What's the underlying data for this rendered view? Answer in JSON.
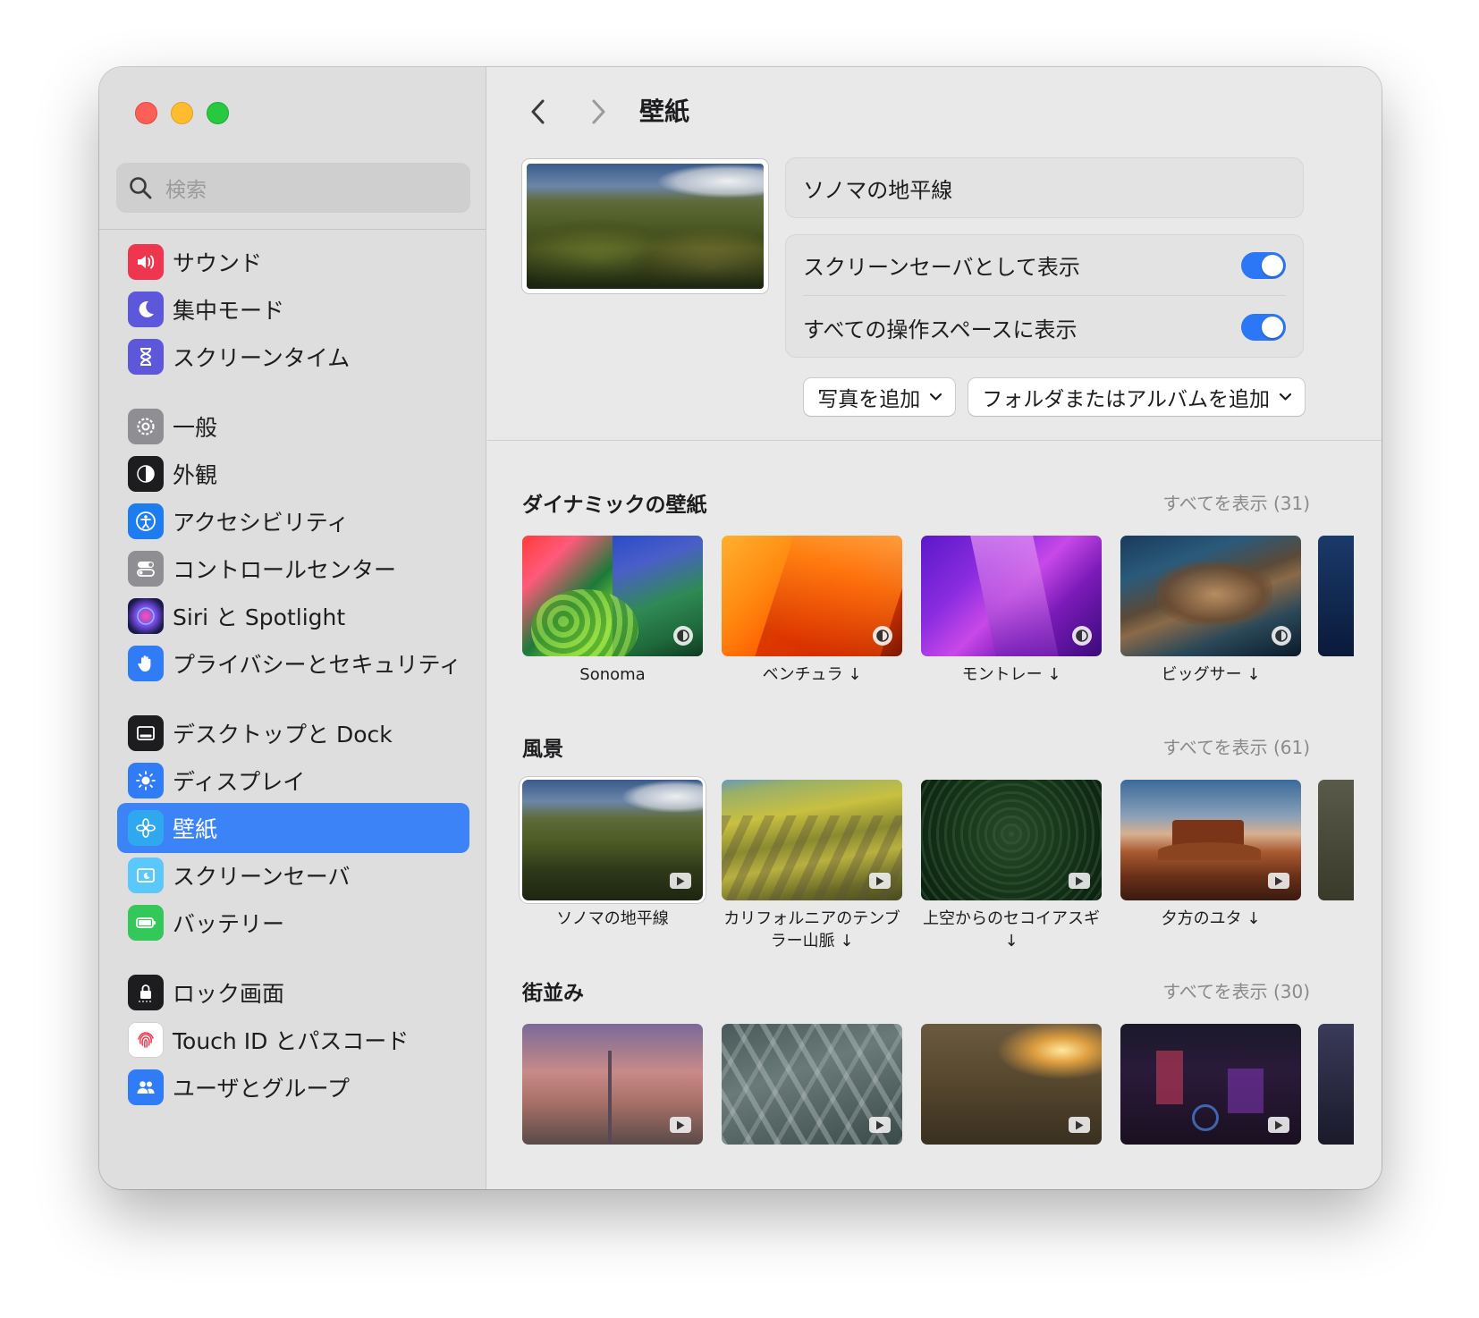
{
  "search": {
    "placeholder": "検索"
  },
  "sidebar": {
    "items": [
      {
        "label": "サウンド",
        "icon": "speaker-icon",
        "color": "#f0364f"
      },
      {
        "label": "集中モード",
        "icon": "moon-icon",
        "color": "#5d57dc"
      },
      {
        "label": "スクリーンタイム",
        "icon": "hourglass-icon",
        "color": "#5d57dc"
      },
      {
        "label": "一般",
        "icon": "gear-icon",
        "color": "#8e8e93"
      },
      {
        "label": "外観",
        "icon": "appearance-icon",
        "color": "#1d1d1f"
      },
      {
        "label": "アクセシビリティ",
        "icon": "accessibility-icon",
        "color": "#1c7cf0"
      },
      {
        "label": "コントロールセンター",
        "icon": "control-center-icon",
        "color": "#8e8e93"
      },
      {
        "label": "Siri と Spotlight",
        "icon": "siri-icon",
        "color": "#4e2a8e"
      },
      {
        "label": "プライバシーとセキュリティ",
        "icon": "hand-icon",
        "color": "#2f7cf6"
      },
      {
        "label": "デスクトップと Dock",
        "icon": "dock-icon",
        "color": "#1d1d1f"
      },
      {
        "label": "ディスプレイ",
        "icon": "sun-icon",
        "color": "#2f7cf6"
      },
      {
        "label": "壁紙",
        "icon": "flower-icon",
        "color": "#2fa8f0"
      },
      {
        "label": "スクリーンセーバ",
        "icon": "screensaver-icon",
        "color": "#5ac8fa"
      },
      {
        "label": "バッテリー",
        "icon": "battery-icon",
        "color": "#34c759"
      },
      {
        "label": "ロック画面",
        "icon": "lock-icon",
        "color": "#1d1d1f"
      },
      {
        "label": "Touch ID とパスコード",
        "icon": "fingerprint-icon",
        "color": "#ffffff"
      },
      {
        "label": "ユーザとグループ",
        "icon": "users-icon",
        "color": "#2f7cf6"
      }
    ],
    "active_label": "壁紙"
  },
  "header": {
    "title": "壁紙"
  },
  "current": {
    "name": "ソノマの地平線",
    "toggle_screensaver": {
      "label": "スクリーンセーバとして表示",
      "on": true
    },
    "toggle_all_spaces": {
      "label": "すべての操作スペースに表示",
      "on": true
    },
    "add_photo": "写真を追加",
    "add_folder": "フォルダまたはアルバムを追加"
  },
  "sections": [
    {
      "title": "ダイナミックの壁紙",
      "show_all": "すべてを表示 (31)",
      "items": [
        {
          "label": "Sonoma"
        },
        {
          "label": "ベンチュラ ↓"
        },
        {
          "label": "モントレー ↓"
        },
        {
          "label": "ビッグサー ↓"
        }
      ]
    },
    {
      "title": "風景",
      "show_all": "すべてを表示 (61)",
      "items": [
        {
          "label": "ソノマの地平線"
        },
        {
          "label": "カリフォルニアのテンブラー山脈 ↓"
        },
        {
          "label": "上空からのセコイアスギ ↓"
        },
        {
          "label": "夕方のユタ ↓"
        }
      ]
    },
    {
      "title": "街並み",
      "show_all": "すべてを表示 (30)",
      "items": [
        {
          "label": ""
        },
        {
          "label": ""
        },
        {
          "label": ""
        },
        {
          "label": ""
        }
      ]
    }
  ],
  "colors": {
    "accent": "#3d83f8",
    "toggle_on": "#2b77f6"
  }
}
